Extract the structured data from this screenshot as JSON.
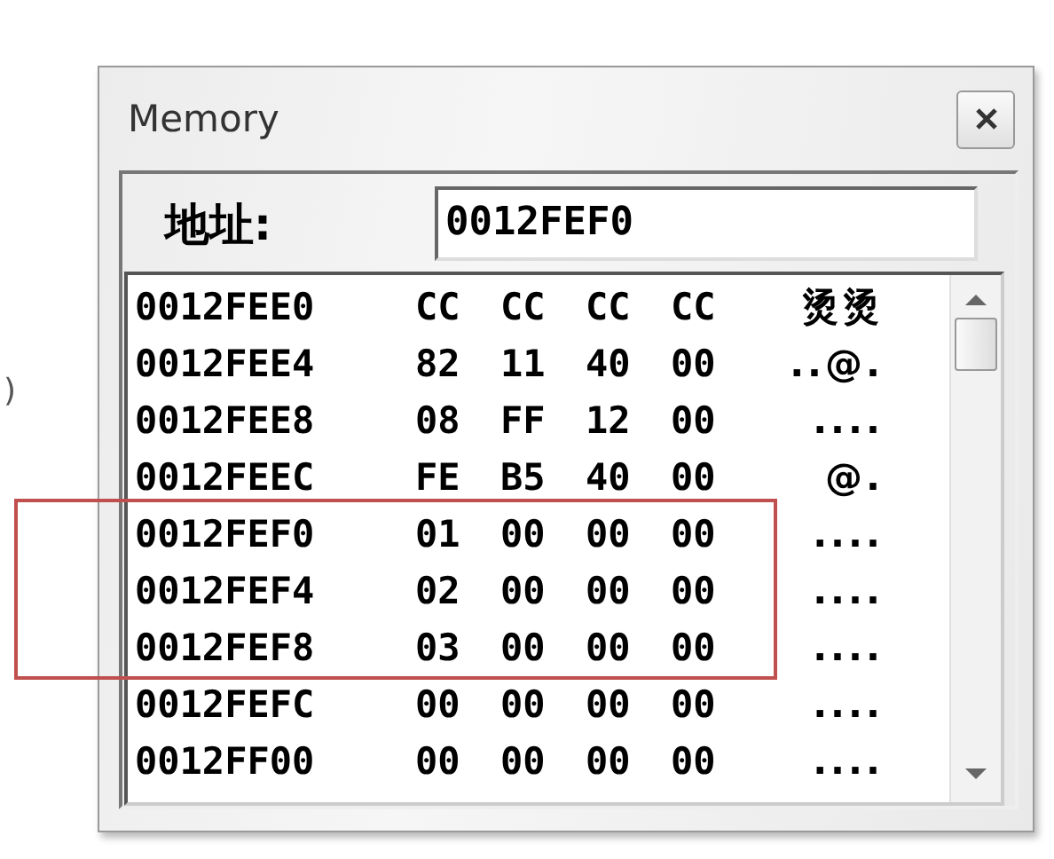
{
  "stray_text": ")",
  "window": {
    "title": "Memory"
  },
  "address": {
    "label": "地址:",
    "value": "0012FEF0"
  },
  "rows": [
    {
      "address": "0012FEE0",
      "bytes": [
        "CC",
        "CC",
        "CC",
        "CC"
      ],
      "ascii": "烫烫",
      "marked": false
    },
    {
      "address": "0012FEE4",
      "bytes": [
        "82",
        "11",
        "40",
        "00"
      ],
      "ascii": "..@.",
      "marked": false
    },
    {
      "address": "0012FEE8",
      "bytes": [
        "08",
        "FF",
        "12",
        "00"
      ],
      "ascii": "....",
      "marked": false
    },
    {
      "address": "0012FEEC",
      "bytes": [
        "FE",
        "B5",
        "40",
        "00"
      ],
      "ascii": "@.",
      "marked": false
    },
    {
      "address": "0012FEF0",
      "bytes": [
        "01",
        "00",
        "00",
        "00"
      ],
      "ascii": "....",
      "marked": true
    },
    {
      "address": "0012FEF4",
      "bytes": [
        "02",
        "00",
        "00",
        "00"
      ],
      "ascii": "....",
      "marked": true
    },
    {
      "address": "0012FEF8",
      "bytes": [
        "03",
        "00",
        "00",
        "00"
      ],
      "ascii": "....",
      "marked": true
    },
    {
      "address": "0012FEFC",
      "bytes": [
        "00",
        "00",
        "00",
        "00"
      ],
      "ascii": "....",
      "marked": false
    },
    {
      "address": "0012FF00",
      "bytes": [
        "00",
        "00",
        "00",
        "00"
      ],
      "ascii": "....",
      "marked": false
    }
  ]
}
